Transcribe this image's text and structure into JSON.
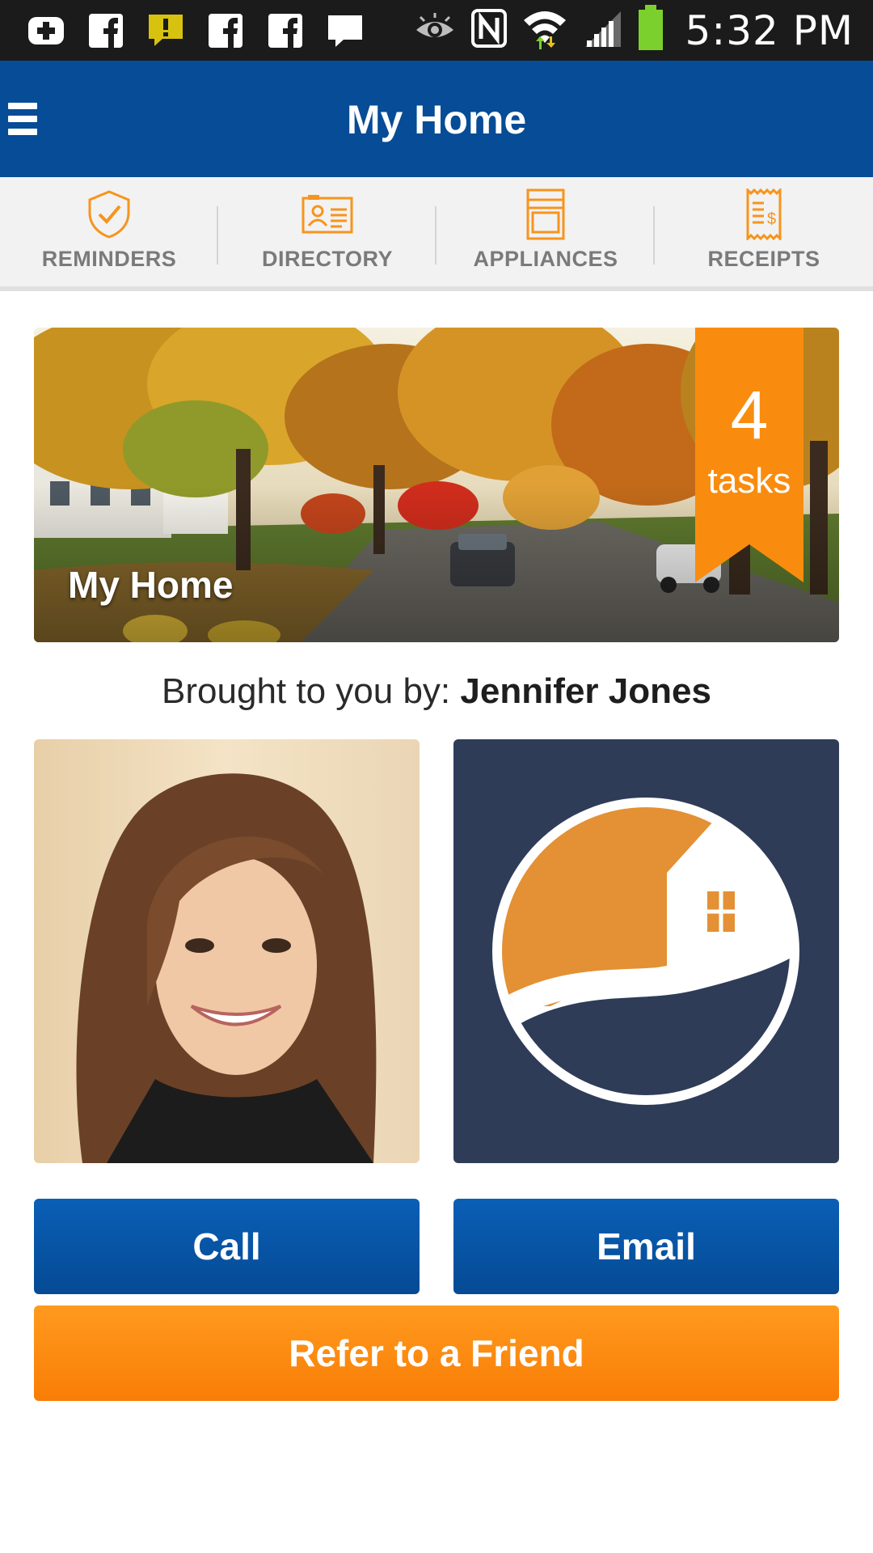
{
  "status_bar": {
    "time": "5:32 PM",
    "left_icons": [
      "add-box-icon",
      "facebook-icon",
      "alert-icon",
      "facebook-icon",
      "facebook-icon",
      "chat-icon"
    ],
    "right_icons": [
      "eye-icon",
      "nfc-icon",
      "wifi-icon",
      "signal-icon",
      "battery-icon"
    ]
  },
  "header": {
    "title": "My Home"
  },
  "tabs": [
    {
      "label": "REMINDERS",
      "icon": "shield-check-icon"
    },
    {
      "label": "DIRECTORY",
      "icon": "contact-card-icon"
    },
    {
      "label": "APPLIANCES",
      "icon": "appliance-icon"
    },
    {
      "label": "RECEIPTS",
      "icon": "receipt-icon"
    }
  ],
  "hero": {
    "title": "My Home",
    "tasks_count": "4",
    "tasks_label": "tasks"
  },
  "agent": {
    "prefix": "Brought to you by: ",
    "name": "Jennifer Jones"
  },
  "buttons": {
    "call": "Call",
    "email": "Email",
    "refer": "Refer to a Friend"
  },
  "colors": {
    "header_blue": "#064c96",
    "accent_orange": "#f98c0e",
    "logo_navy": "#2e3c58"
  }
}
